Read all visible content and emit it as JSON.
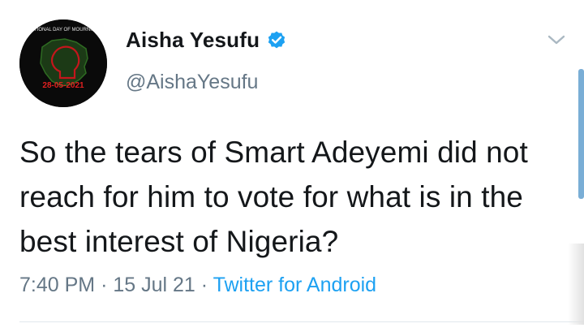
{
  "user": {
    "display_name": "Aisha Yesufu",
    "handle": "@AishaYesufu",
    "avatar_top_text": "NATIONAL DAY OF MOURNING",
    "avatar_date": "28-05-2021"
  },
  "tweet": {
    "text": "So the tears of Smart Adeyemi did not reach for him to vote for what is in the best interest of Nigeria?",
    "time": "7:40 PM",
    "date": "15 Jul 21",
    "source": "Twitter for Android",
    "separator": "·"
  },
  "colors": {
    "text": "#14171a",
    "secondary": "#657786",
    "accent": "#1da1f2"
  },
  "icons": {
    "verified": "verified-badge-icon",
    "menu": "chevron-down-icon"
  }
}
